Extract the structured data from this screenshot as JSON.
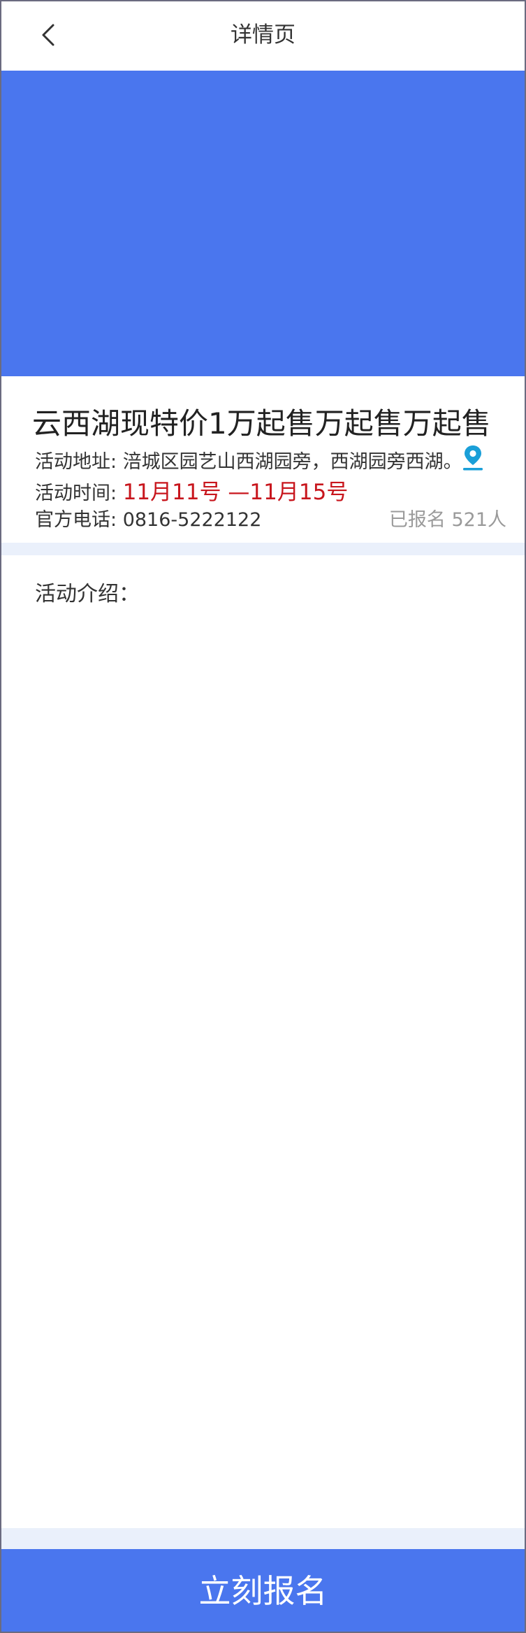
{
  "header": {
    "title": "详情页",
    "back_icon": "chevron-left-icon"
  },
  "banner": {
    "color": "#4a76ee"
  },
  "event": {
    "title": "云西湖现特价1万起售万起售万起售",
    "address_label": "活动地址: ",
    "address_value": "涪城区园艺山西湖园旁，西湖园旁西湖。",
    "location_icon": "map-pin-icon",
    "time_label": "活动时间: ",
    "time_value": "11月11号 —11月15号",
    "phone_label": "官方电话: ",
    "phone_value": "0816-5222122",
    "signup_count": "已报名 521人"
  },
  "intro": {
    "label": "活动介绍："
  },
  "actions": {
    "signup_label": "立刻报名"
  },
  "colors": {
    "accent": "#4a76ee",
    "highlight": "#c8161d",
    "muted": "#9a9a9a",
    "divider": "#eaf0fb",
    "location_icon": "#1a9fd8"
  }
}
